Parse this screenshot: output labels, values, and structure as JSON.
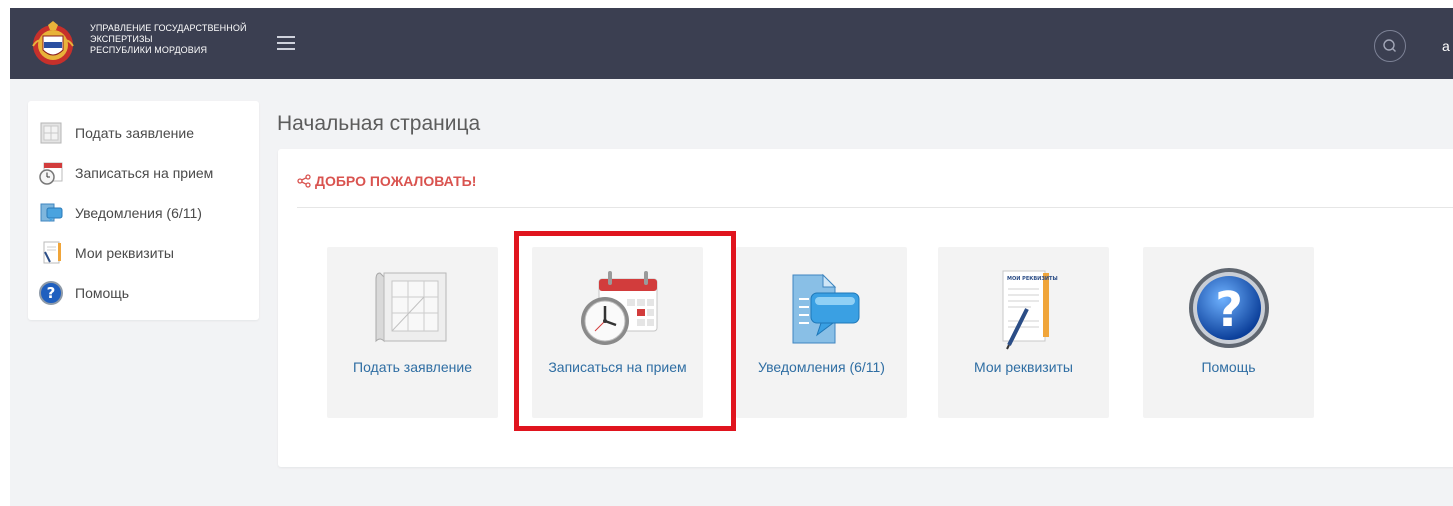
{
  "header": {
    "brand_lines": [
      "УПРАВЛЕНИЕ ГОСУДАРСТВЕННОЙ",
      "ЭКСПЕРТИЗЫ",
      "РЕСПУБЛИКИ МОРДОВИЯ"
    ],
    "user_initial": "a",
    "icons": [
      "coat-of-arms-logo",
      "hamburger-icon",
      "search-icon"
    ],
    "color": "#3b3f51"
  },
  "sidebar": {
    "items": [
      {
        "label": "Подать заявление",
        "icon": "blueprint-icon"
      },
      {
        "label": "Записаться на прием",
        "icon": "calendar-clock-icon"
      },
      {
        "label": "Уведомления (6/11)",
        "icon": "notification-icon"
      },
      {
        "label": "Мои реквизиты",
        "icon": "document-pen-icon"
      },
      {
        "label": "Помощь",
        "icon": "help-icon"
      }
    ]
  },
  "main": {
    "page_title": "Начальная страница",
    "welcome": "ДОБРО ПОЖАЛОВАТЬ!",
    "tiles": [
      {
        "label": "Подать заявление",
        "icon": "blueprint-icon"
      },
      {
        "label": "Записаться на прием",
        "icon": "calendar-clock-icon"
      },
      {
        "label": "Уведомления (6/11)",
        "icon": "notification-icon"
      },
      {
        "label": "Мои реквизиты",
        "icon": "document-pen-icon",
        "icon_caption": "МОИ РЕКВИЗИТЫ"
      },
      {
        "label": "Помощь",
        "icon": "help-icon"
      }
    ]
  },
  "colors": {
    "accent": "#d9534f",
    "link": "#2f6ea3",
    "highlight": "#e0141e"
  }
}
